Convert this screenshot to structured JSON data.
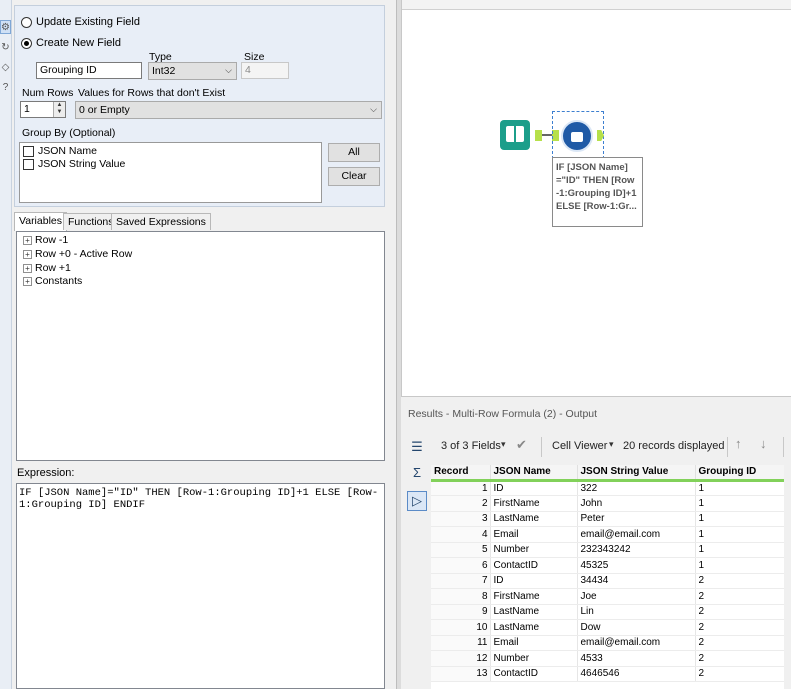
{
  "config": {
    "radio_update": "Update Existing Field",
    "radio_create": "Create New  Field",
    "field_name": "Grouping ID",
    "type_label": "Type",
    "type_value": "Int32",
    "size_label": "Size",
    "size_value": "4",
    "num_rows_label": "Num Rows",
    "num_rows_value": "1",
    "nonexist_label": "Values for Rows that don't Exist",
    "nonexist_value": "0 or Empty",
    "groupby_label": "Group By (Optional)",
    "groupby_fields": [
      "JSON Name",
      "JSON String Value"
    ],
    "all_button": "All",
    "clear_button": "Clear"
  },
  "tabs": [
    "Variables",
    "Functions",
    "Saved Expressions"
  ],
  "tree_items": [
    "Row -1",
    "Row +0 - Active Row",
    "Row +1",
    "Constants"
  ],
  "expression": {
    "label": "Expression:",
    "text": "IF [JSON Name]=\"ID\" THEN [Row-1:Grouping ID]+1 ELSE [Row-1:Grouping ID] ENDIF"
  },
  "canvas": {
    "annotation": "IF [JSON Name]\n=\"ID\" THEN [Row\n-1:Grouping ID]+1\nELSE [Row-1:Gr..."
  },
  "results": {
    "title": "Results - Multi-Row Formula (2) - Output",
    "fields_count": "3 of 3 Fields",
    "cell_viewer": "Cell Viewer",
    "records_displayed": "20 records displayed",
    "columns": [
      "Record",
      "JSON Name",
      "JSON String Value",
      "Grouping ID"
    ],
    "rows": [
      [
        "1",
        "ID",
        "322",
        "1"
      ],
      [
        "2",
        "FirstName",
        "John",
        "1"
      ],
      [
        "3",
        "LastName",
        "Peter",
        "1"
      ],
      [
        "4",
        "Email",
        "email@email.com",
        "1"
      ],
      [
        "5",
        "Number",
        "232343242",
        "1"
      ],
      [
        "6",
        "ContactID",
        "45325",
        "1"
      ],
      [
        "7",
        "ID",
        "34434",
        "2"
      ],
      [
        "8",
        "FirstName",
        "Joe",
        "2"
      ],
      [
        "9",
        "LastName",
        "Lin",
        "2"
      ],
      [
        "10",
        "LastName",
        "Dow",
        "2"
      ],
      [
        "11",
        "Email",
        "email@email.com",
        "2"
      ],
      [
        "12",
        "Number",
        "4533",
        "2"
      ],
      [
        "13",
        "ContactID",
        "4646546",
        "2"
      ]
    ]
  }
}
